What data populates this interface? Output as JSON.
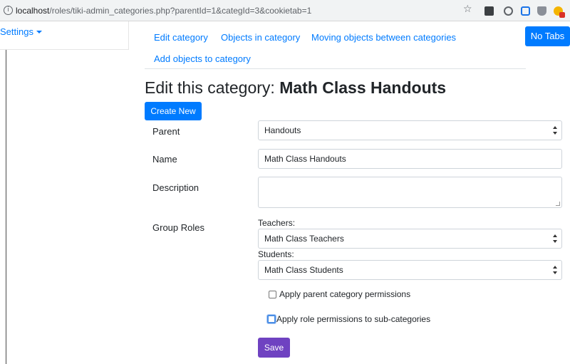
{
  "browser": {
    "url_host": "localhost",
    "url_rest": "/roles/tiki-admin_categories.php?parentId=1&categId=3&cookietab=1",
    "info_glyph": "i",
    "star_glyph": "☆",
    "icons": [
      "info-icon",
      "bookmark-star-icon",
      "extension-icon",
      "extension-icon",
      "extension-icon",
      "extension-icon",
      "extension-icon"
    ]
  },
  "sidebar": {
    "settings_label": "Settings"
  },
  "tabs": [
    {
      "label": "Edit category"
    },
    {
      "label": "Objects in category"
    },
    {
      "label": "Moving objects between categories"
    },
    {
      "label": "Add objects to category"
    }
  ],
  "toolbar": {
    "no_tabs_label": "No Tabs"
  },
  "page": {
    "title_prefix": "Edit this category: ",
    "title_name": "Math Class Handouts",
    "create_new_label": "Create New"
  },
  "form": {
    "parent": {
      "label": "Parent",
      "value": "Handouts"
    },
    "name": {
      "label": "Name",
      "value": "Math Class Handouts"
    },
    "description": {
      "label": "Description",
      "value": ""
    },
    "group_roles": {
      "label": "Group Roles",
      "teachers_label": "Teachers:",
      "teachers_value": "Math Class Teachers",
      "students_label": "Students:",
      "students_value": "Math Class Students"
    },
    "apply_parent_label": "Apply parent category permissions",
    "apply_role_label": "Apply role permissions to sub-categories",
    "save_label": "Save"
  },
  "colors": {
    "primary": "#007bff",
    "save": "#6f42c1"
  }
}
